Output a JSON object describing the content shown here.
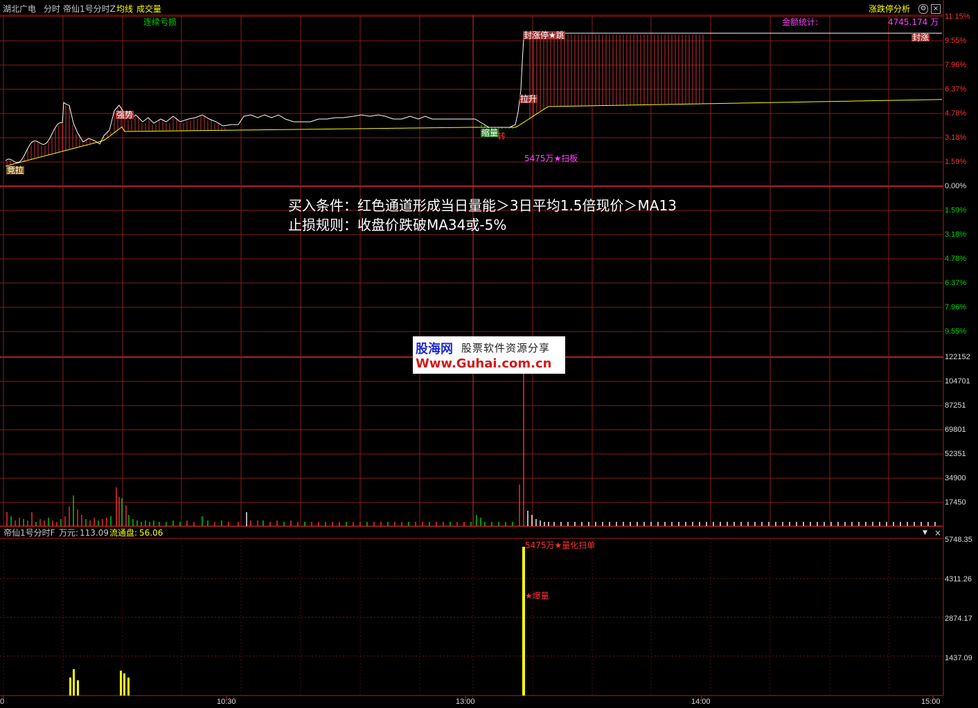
{
  "header": {
    "stock_name": "湖北广电",
    "mode": "分时",
    "indicator": "帝仙1号分时Z",
    "avg_line": "均线",
    "volume": "成交量",
    "right_tab": "涨跌停分析",
    "settings_icon": "gear-icon",
    "close_icon": "close-icon"
  },
  "price_panel": {
    "y_labels_up": [
      "11.15%",
      "9.55%",
      "7.96%",
      "6.37%",
      "4.78%",
      "3.18%",
      "1.59%",
      "0.00%"
    ],
    "y_labels_down": [
      "1.59%",
      "3.18%",
      "4.78%",
      "6.37%",
      "7.96%",
      "9.55%"
    ],
    "annotations": {
      "continuous_loss": "连续亏损",
      "amount_stats": "金额统计:",
      "amount_value": "4745.174 万",
      "seal": "封涨",
      "bid": "竞拉",
      "strong": "强势",
      "shrink": "缩量",
      "turn": "转",
      "pullup": "拉升",
      "limit_note": "封涨停★跳",
      "sweep": "5475万★扫板"
    },
    "colors": {
      "up": "#ff3232",
      "down": "#00d700",
      "price_line": "#ffffff",
      "avg_line": "#ffff00",
      "grid": "#8b1a1a"
    }
  },
  "strategy_text": {
    "line1": "买入条件：红色通道形成当日量能＞3日平均1.5倍现价＞MA13",
    "line2": "止损规则：收盘价跌破MA34或-5%"
  },
  "watermark": {
    "brand": "股海网",
    "slogan": "股票软件资源分享",
    "url": "Www.Guhai.com.cn"
  },
  "volume_panel": {
    "y_labels": [
      "122152",
      "104701",
      "87251",
      "69801",
      "52351",
      "34900",
      "17450"
    ]
  },
  "indicator_panel": {
    "title": "帝仙1号分时F",
    "wan_label": "万元:",
    "wan_value": "113.09",
    "float_label": "流通盘:",
    "float_value": "56.06",
    "y_labels": [
      "5748.35",
      "4311.26",
      "2874.17",
      "1437.09"
    ],
    "ann_sweep": "5475万★量化扫单",
    "ann_burst": "★爆量",
    "dropdown_icon": "chevron-down-icon",
    "close_icon": "close-icon"
  },
  "time_axis": [
    "0",
    "10:30",
    "13:00",
    "14:00",
    "15:00"
  ]
}
